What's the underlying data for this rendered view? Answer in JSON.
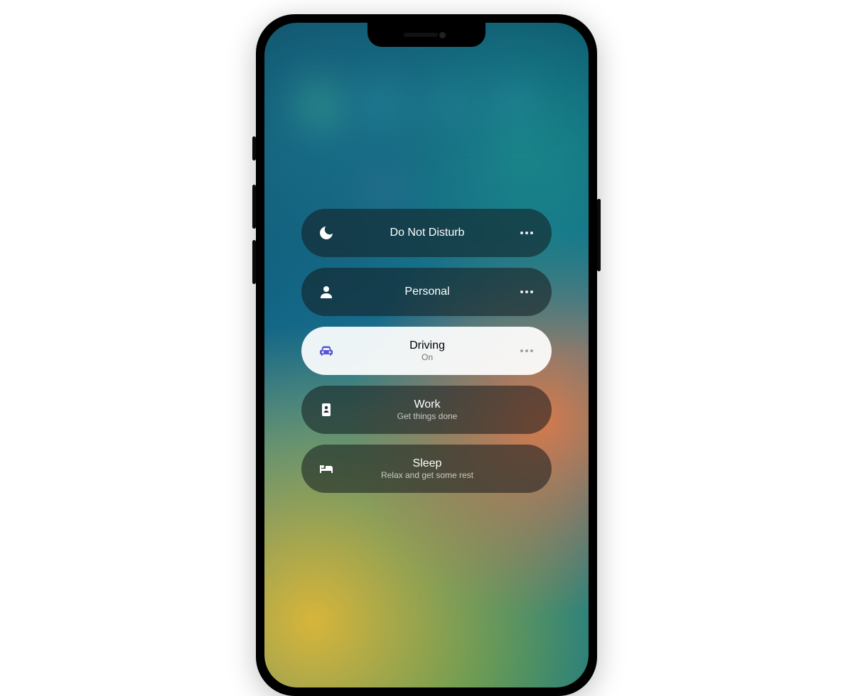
{
  "device": "iPhone",
  "ui": "Control Center – Focus modes",
  "focus_modes": [
    {
      "icon": "moon",
      "label": "Do Not Disturb",
      "subtitle": "",
      "active": false,
      "has_more": true
    },
    {
      "icon": "person",
      "label": "Personal",
      "subtitle": "",
      "active": false,
      "has_more": true
    },
    {
      "icon": "car",
      "label": "Driving",
      "subtitle": "On",
      "active": true,
      "has_more": true
    },
    {
      "icon": "badge",
      "label": "Work",
      "subtitle": "Get things done",
      "active": false,
      "has_more": false
    },
    {
      "icon": "bed",
      "label": "Sleep",
      "subtitle": "Relax and get some rest",
      "active": false,
      "has_more": false
    }
  ],
  "colors": {
    "pill_dark": "rgba(20,25,30,.55)",
    "pill_active": "rgba(255,255,255,.92)",
    "active_icon": "#5856d6"
  }
}
